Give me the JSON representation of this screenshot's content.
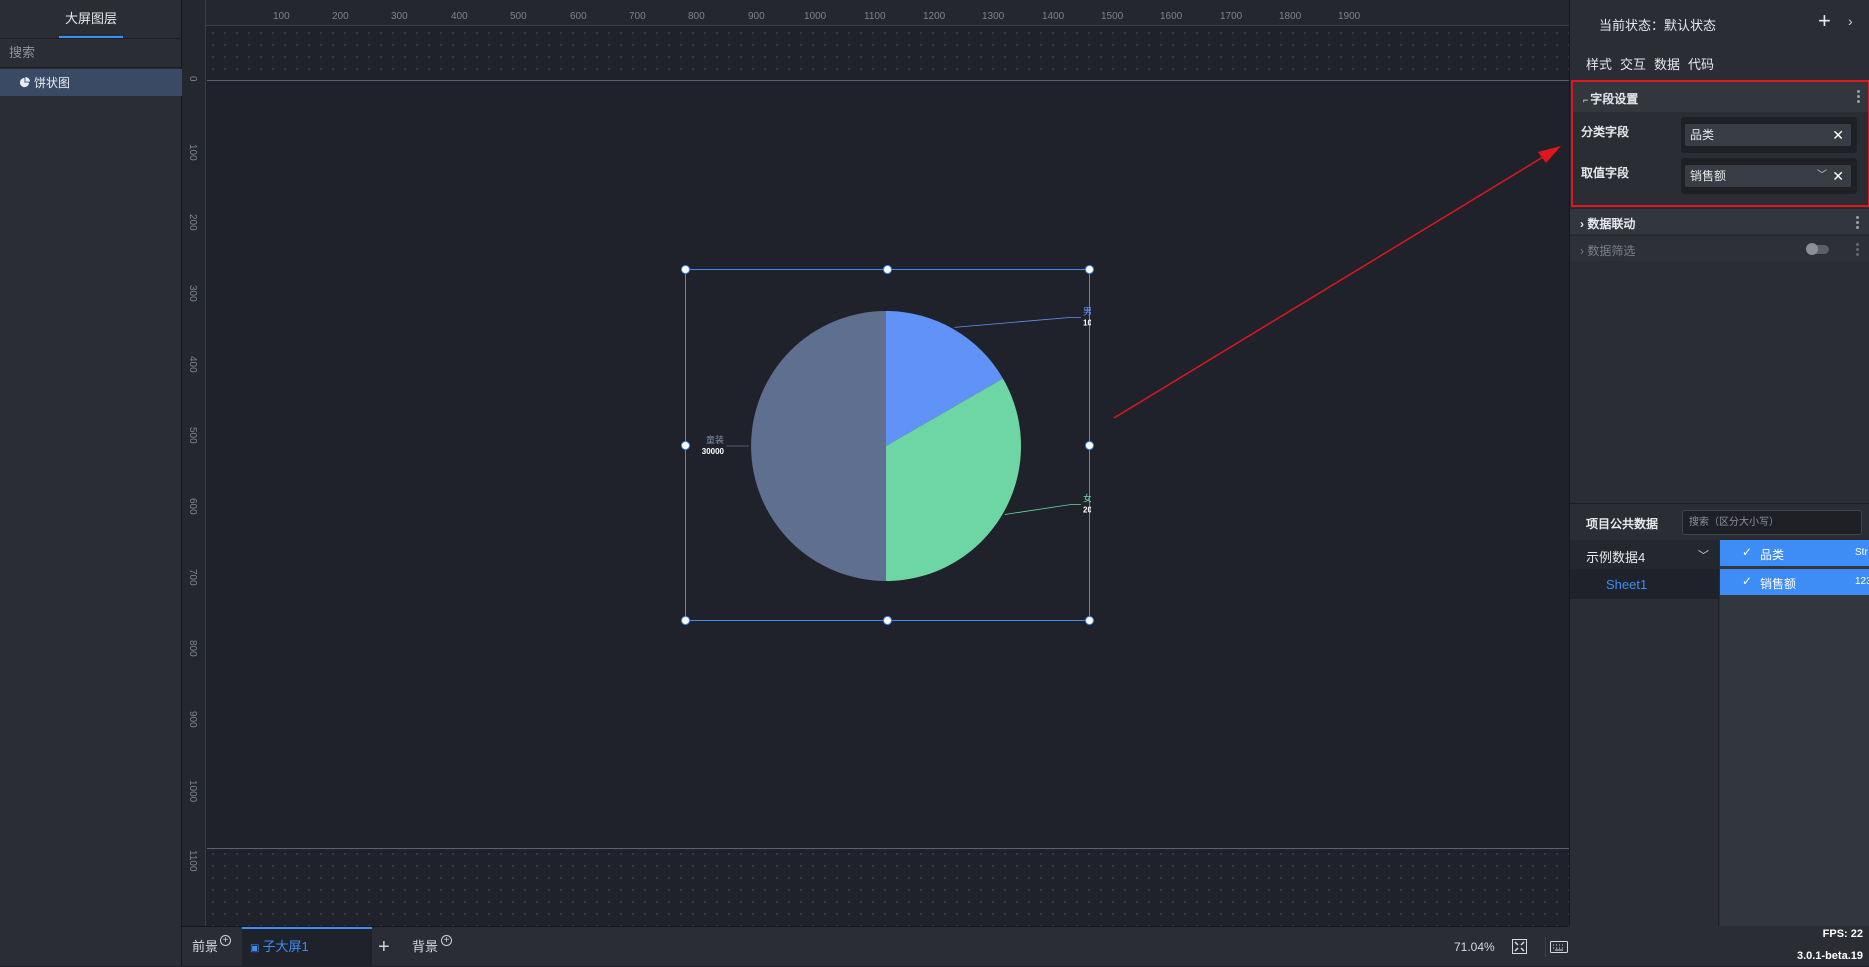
{
  "left_panel": {
    "tab_label": "大屏图层",
    "search_label": "搜索",
    "layers": [
      {
        "label": "饼状图",
        "icon": "pie-chart-icon"
      }
    ]
  },
  "canvas": {
    "ruler_h": [
      "100",
      "200",
      "300",
      "400",
      "500",
      "600",
      "700",
      "800",
      "900",
      "1000",
      "1100",
      "1200",
      "1300",
      "1400",
      "1500",
      "1600",
      "1700",
      "1800",
      "1900"
    ],
    "ruler_v": [
      "0",
      "100",
      "200",
      "300",
      "400",
      "500",
      "600",
      "700",
      "800",
      "900",
      "1000",
      "1100"
    ]
  },
  "chart_data": {
    "type": "pie",
    "title": "",
    "categories": [
      "男装",
      "女装",
      "童装"
    ],
    "values": [
      10000,
      20000,
      30000
    ],
    "colors": [
      "#6192f7",
      "#6dd6a4",
      "#5f6f8f"
    ],
    "label_colors": [
      "#6192f7",
      "#6dd6a4",
      "#7f8ca8"
    ]
  },
  "bottom_bar": {
    "foreground_label": "前景",
    "sub_screen_label": "子大屏1",
    "add_label": "+",
    "background_label": "背景",
    "zoom_label": "71.04%"
  },
  "right_panel": {
    "state_label": "当前状态：默认状态",
    "state_add": "+",
    "state_more": "›",
    "tabs": [
      "样式",
      "交互",
      "数据",
      "代码"
    ],
    "field_settings": {
      "title": "字段设置",
      "category_label": "分类字段",
      "category_value": "品类",
      "value_label": "取值字段",
      "value_value": "销售额"
    },
    "data_link_title": "数据联动",
    "data_filter_title": "数据筛选",
    "public_data": {
      "title": "项目公共数据",
      "search_placeholder": "搜索（区分大小写）",
      "dataset": "示例数据4",
      "sheet": "Sheet1",
      "fields": [
        {
          "name": "品类",
          "type": "Str"
        },
        {
          "name": "销售额",
          "type": "123"
        }
      ]
    }
  },
  "status": {
    "fps": "FPS: 22",
    "version": "3.0.1-beta.19"
  }
}
